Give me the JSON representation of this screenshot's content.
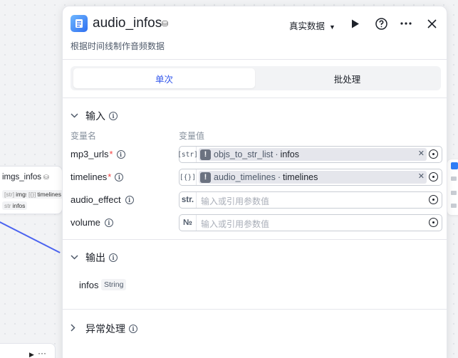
{
  "canvas": {
    "node": {
      "title": "imgs_infos",
      "badge": "⛁",
      "chips": [
        {
          "type": "[str]",
          "name": "imgs"
        },
        {
          "type": "[{}]",
          "name": "timelines"
        },
        {
          "type": "str",
          "name": "infos"
        }
      ]
    },
    "edge_colors": {
      "connector": "#4b63f0"
    }
  },
  "panel": {
    "title": "audio_infos",
    "title_badge": "⛁",
    "subtitle": "根据时间线制作音频数据",
    "data_mode": "真实数据",
    "icons": {
      "run": "play-icon",
      "help": "help-icon",
      "more": "more-icon",
      "close": "close-icon",
      "node": "audio-node-icon"
    },
    "tabs": [
      {
        "label": "单次",
        "active": true
      },
      {
        "label": "批处理",
        "active": false
      }
    ],
    "input_section": {
      "title": "输入",
      "col_name": "变量名",
      "col_value": "变量值",
      "rows": [
        {
          "name": "mp3_urls",
          "required": "*",
          "type": "[str]",
          "ref_node": "objs_to_str_list",
          "ref_sep": "·",
          "ref_var": "infos"
        },
        {
          "name": "timelines",
          "required": "*",
          "type": "[{}]",
          "ref_node": "audio_timelines",
          "ref_sep": "·",
          "ref_var": "timelines"
        },
        {
          "name": "audio_effect",
          "required": "",
          "type": "str.",
          "placeholder": "输入或引用参数值"
        },
        {
          "name": "volume",
          "required": "",
          "type": "№",
          "placeholder": "输入或引用参数值"
        }
      ]
    },
    "output_section": {
      "title": "输出",
      "items": [
        {
          "name": "infos",
          "type": "String"
        }
      ]
    },
    "error_section": {
      "title": "异常处理"
    },
    "accent_color": "#2f54eb",
    "required_color": "#f53f3f"
  }
}
